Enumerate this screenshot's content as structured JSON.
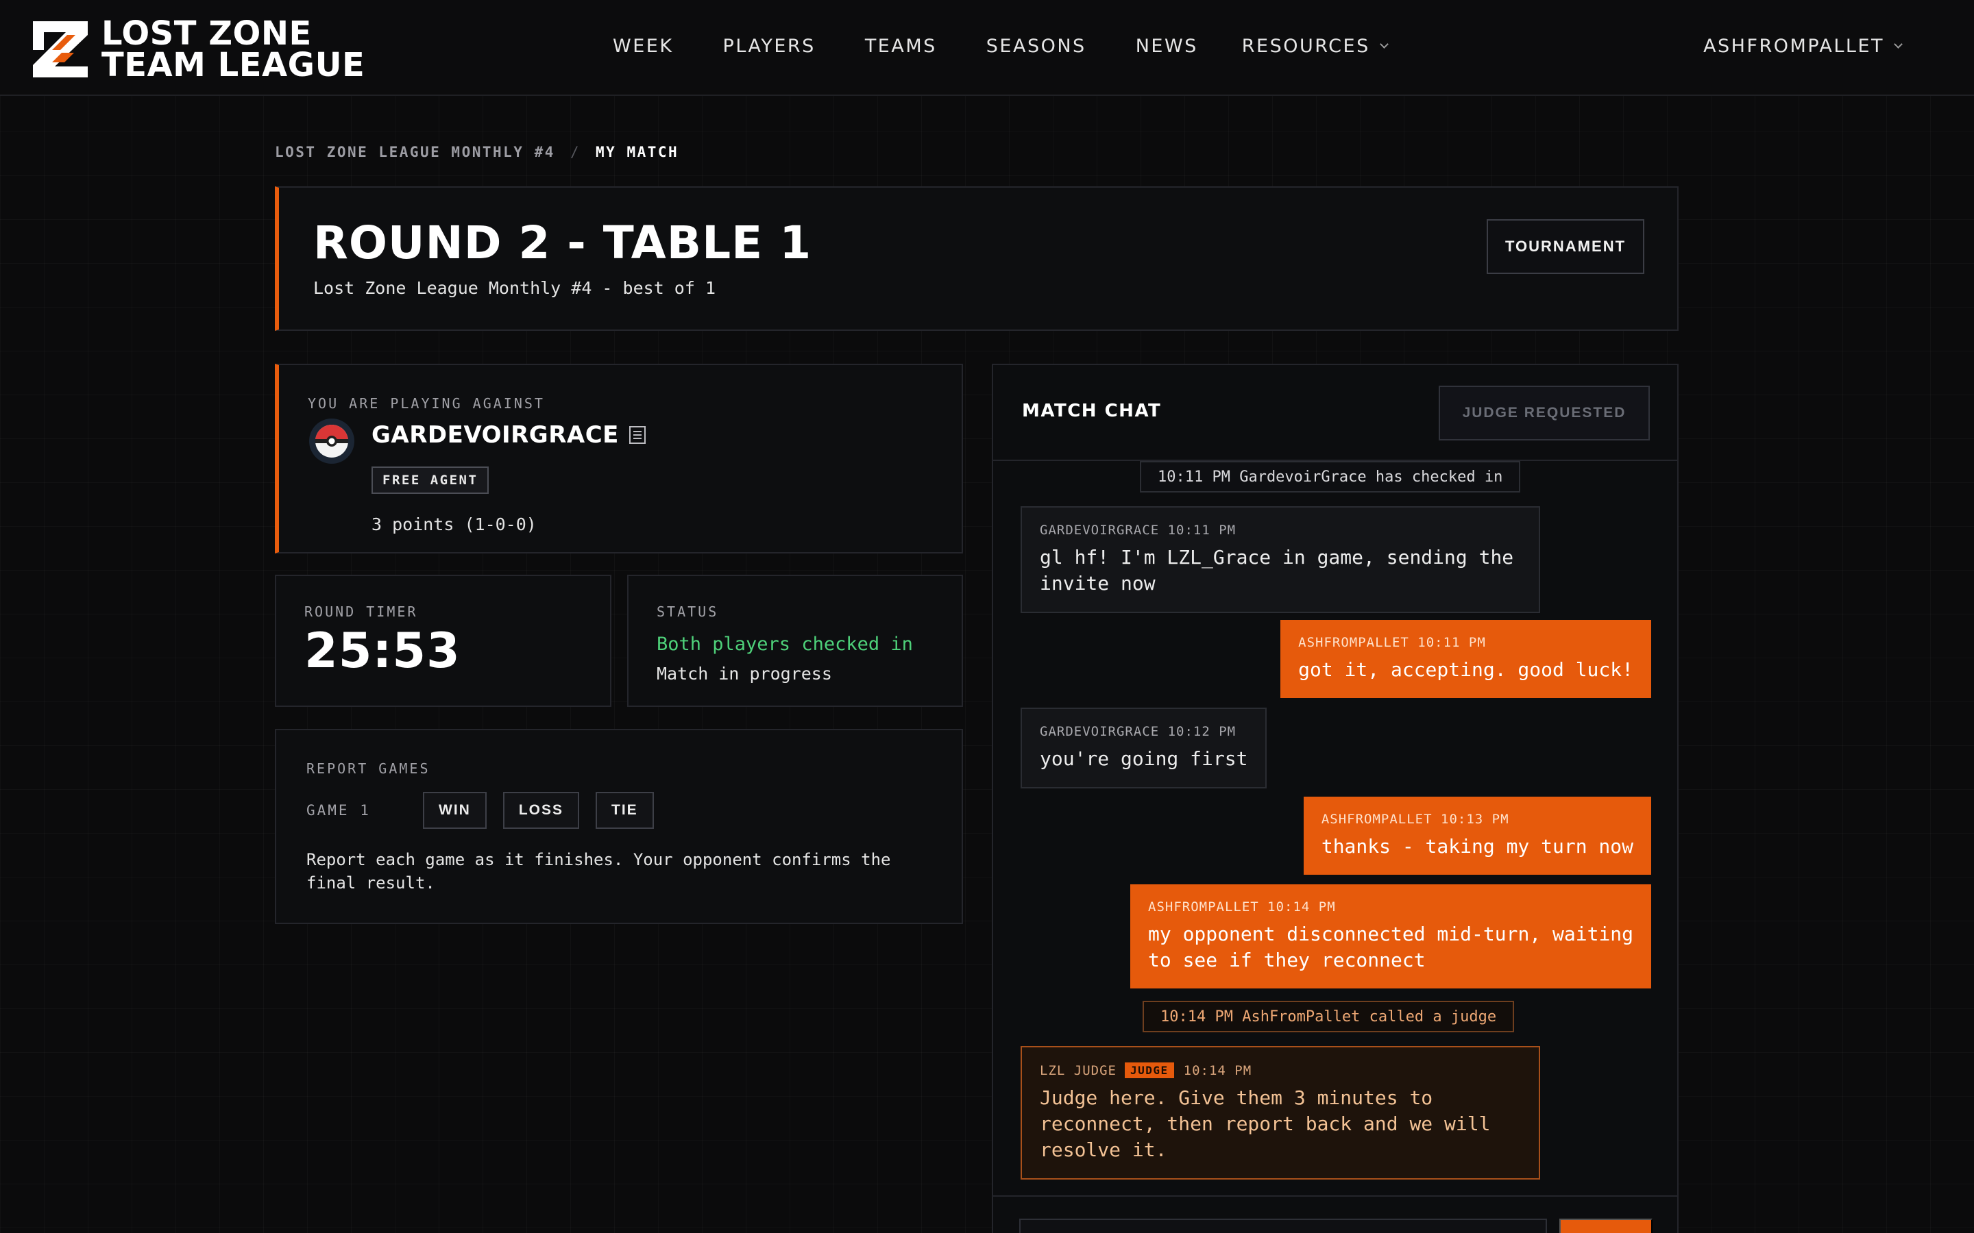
{
  "brand": {
    "line1": "LOST ZONE",
    "line2": "TEAM LEAGUE",
    "accent": "#e85c0d"
  },
  "nav": {
    "items": [
      "WEEK",
      "PLAYERS",
      "TEAMS",
      "SEASONS",
      "NEWS"
    ],
    "resources": "RESOURCES",
    "user": "ASHFROMPALLET"
  },
  "breadcrumb": {
    "parent": "LOST ZONE LEAGUE MONTHLY #4",
    "separator": "/",
    "current": "MY MATCH"
  },
  "match": {
    "title": "ROUND 2 - TABLE 1",
    "subtitle": "Lost Zone League Monthly #4 - best of 1",
    "tournament_button": "TOURNAMENT"
  },
  "opponent": {
    "label": "YOU ARE PLAYING AGAINST",
    "name": "GARDEVOIRGRACE",
    "badge": "FREE AGENT",
    "record": "3 points (1-0-0)"
  },
  "timer": {
    "label": "ROUND TIMER",
    "value": "25:53"
  },
  "status": {
    "label": "STATUS",
    "line1": "Both players checked in",
    "line2": "Match in progress",
    "ok_color": "#4ed17a"
  },
  "report": {
    "label": "REPORT GAMES",
    "game_label": "GAME 1",
    "win": "WIN",
    "loss": "LOSS",
    "tie": "TIE",
    "note": "Report each game as it finishes. Your opponent confirms the final result."
  },
  "chat": {
    "title": "MATCH CHAT",
    "judge_button": "JUDGE REQUESTED",
    "messages": [
      {
        "kind": "system",
        "text": "10:11 PM GardevoirGrace has checked in"
      },
      {
        "kind": "in",
        "author": "GARDEVOIRGRACE",
        "time": "10:11 PM",
        "text": "gl hf! I'm LZL_Grace in game, sending the invite now"
      },
      {
        "kind": "out",
        "author": "ASHFROMPALLET",
        "time": "10:11 PM",
        "text": "got it, accepting. good luck!"
      },
      {
        "kind": "in",
        "author": "GARDEVOIRGRACE",
        "time": "10:12 PM",
        "text": "you're going first"
      },
      {
        "kind": "out",
        "author": "ASHFROMPALLET",
        "time": "10:13 PM",
        "text": "thanks - taking my turn now"
      },
      {
        "kind": "out",
        "author": "ASHFROMPALLET",
        "time": "10:14 PM",
        "text": "my opponent disconnected mid-turn, waiting to see if they reconnect"
      },
      {
        "kind": "system-warn",
        "text": "10:14 PM AshFromPallet called a judge"
      },
      {
        "kind": "judge",
        "author": "LZL JUDGE",
        "badge": "JUDGE",
        "time": "10:14 PM",
        "text": "Judge here. Give them 3 minutes to reconnect, then report back and we will resolve it."
      }
    ]
  }
}
